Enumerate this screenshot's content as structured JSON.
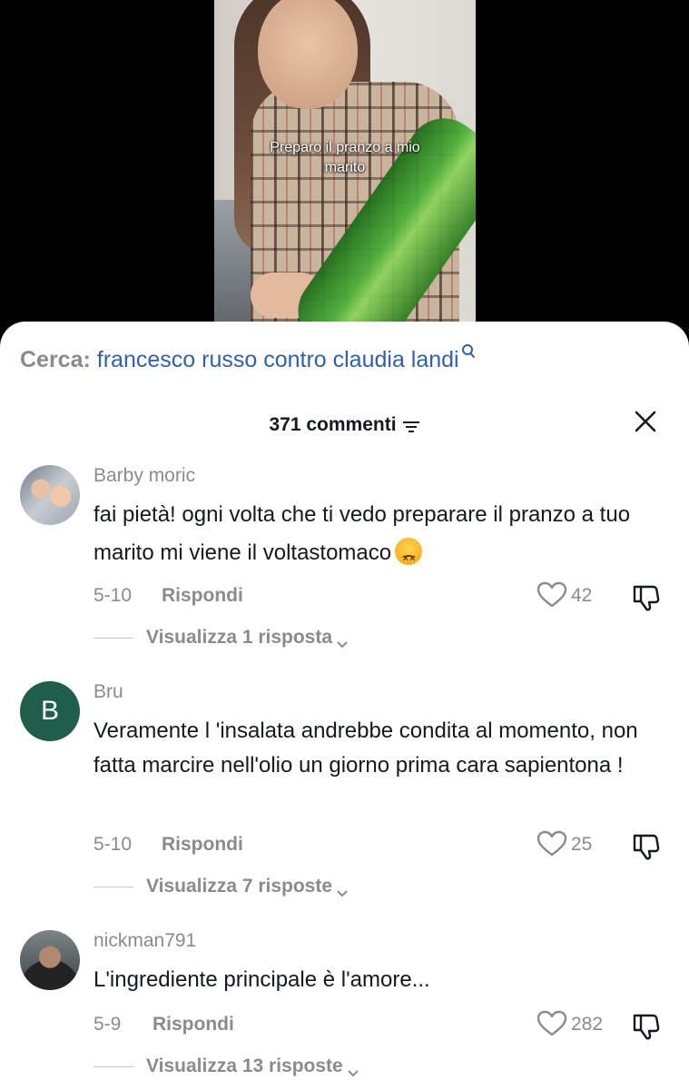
{
  "video": {
    "caption": "Preparo il pranzo a mio marito"
  },
  "search": {
    "prefix": "Cerca:",
    "query": "francesco russo contro claudia landi"
  },
  "header": {
    "comment_count": "371 commenti"
  },
  "comments": [
    {
      "username": "Barby moric",
      "text": "fai pietà! ogni volta che ti vedo preparare il pranzo a tuo marito mi viene il voltastomaco",
      "date": "5-10",
      "reply_label": "Rispondi",
      "likes": "42",
      "view_replies": "Visualizza 1 risposta"
    },
    {
      "username": "Bru",
      "avatar_letter": "B",
      "text": "Veramente l 'insalata andrebbe condita al momento, non fatta marcire nell'olio un giorno prima cara sapientona !",
      "date": "5-10",
      "reply_label": "Rispondi",
      "likes": "25",
      "view_replies": "Visualizza 7 risposte"
    },
    {
      "username": "nickman791",
      "text": "L'ingrediente principale è l'amore...",
      "date": "5-9",
      "reply_label": "Rispondi",
      "likes": "282",
      "view_replies": "Visualizza 13 risposte"
    }
  ],
  "colors": {
    "accent_link": "#2f5fb0",
    "muted_text": "#8a8b91",
    "primary_text": "#161823",
    "avatar_bru_bg": "#1f5d4c"
  }
}
